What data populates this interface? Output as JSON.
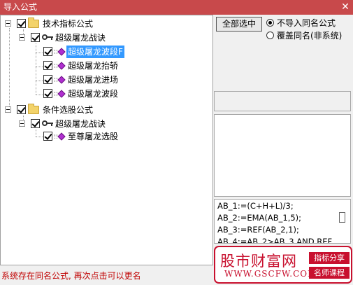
{
  "window": {
    "title": "导入公式",
    "close_glyph": "✕"
  },
  "tree": {
    "nodes": [
      {
        "label": "技术指标公式",
        "icon": "folder-icon",
        "checked": true,
        "expanded": true
      },
      {
        "label": "超级屠龙战诀",
        "icon": "key-icon",
        "checked": true,
        "expanded": true
      },
      {
        "label": "超级屠龙波段F",
        "icon": "formula-gem-icon",
        "checked": true,
        "selected": true
      },
      {
        "label": "超级屠龙抬轿",
        "icon": "formula-gem-icon",
        "checked": true
      },
      {
        "label": "超级屠龙进场",
        "icon": "formula-gem-icon",
        "checked": true
      },
      {
        "label": "超级屠龙波段",
        "icon": "formula-gem-icon",
        "checked": true
      },
      {
        "label": "条件选股公式",
        "icon": "folder-icon",
        "checked": true,
        "expanded": true
      },
      {
        "label": "超级屠龙战诀",
        "icon": "key-icon",
        "checked": true,
        "expanded": true
      },
      {
        "label": "至尊屠龙选股",
        "icon": "formula-gem-icon",
        "checked": true
      }
    ]
  },
  "options": {
    "select_all_label": "全部选中",
    "radio_no_import": "不导入同名公式",
    "radio_overwrite": "覆盖同名(非系统)",
    "selected": "radio_no_import"
  },
  "code": {
    "lines": [
      "AB_1:=(C+H+L)/3;",
      "AB_2:=EMA(AB_1,5);",
      "AB_3:=REF(AB_2,1);",
      "AB_4:=AB_2>AB_3 AND REF"
    ]
  },
  "status": "系统存在同名公式, 再次点击可以更名",
  "watermark": {
    "name": "股市财富网",
    "url": "WWW.GSCFW.COM",
    "badge1": "指标分享",
    "badge2": "名师课程",
    "color": "#c8102e"
  },
  "colors": {
    "titlebar": "#c8494b",
    "selection": "#3399ff",
    "status": "#c00000"
  }
}
